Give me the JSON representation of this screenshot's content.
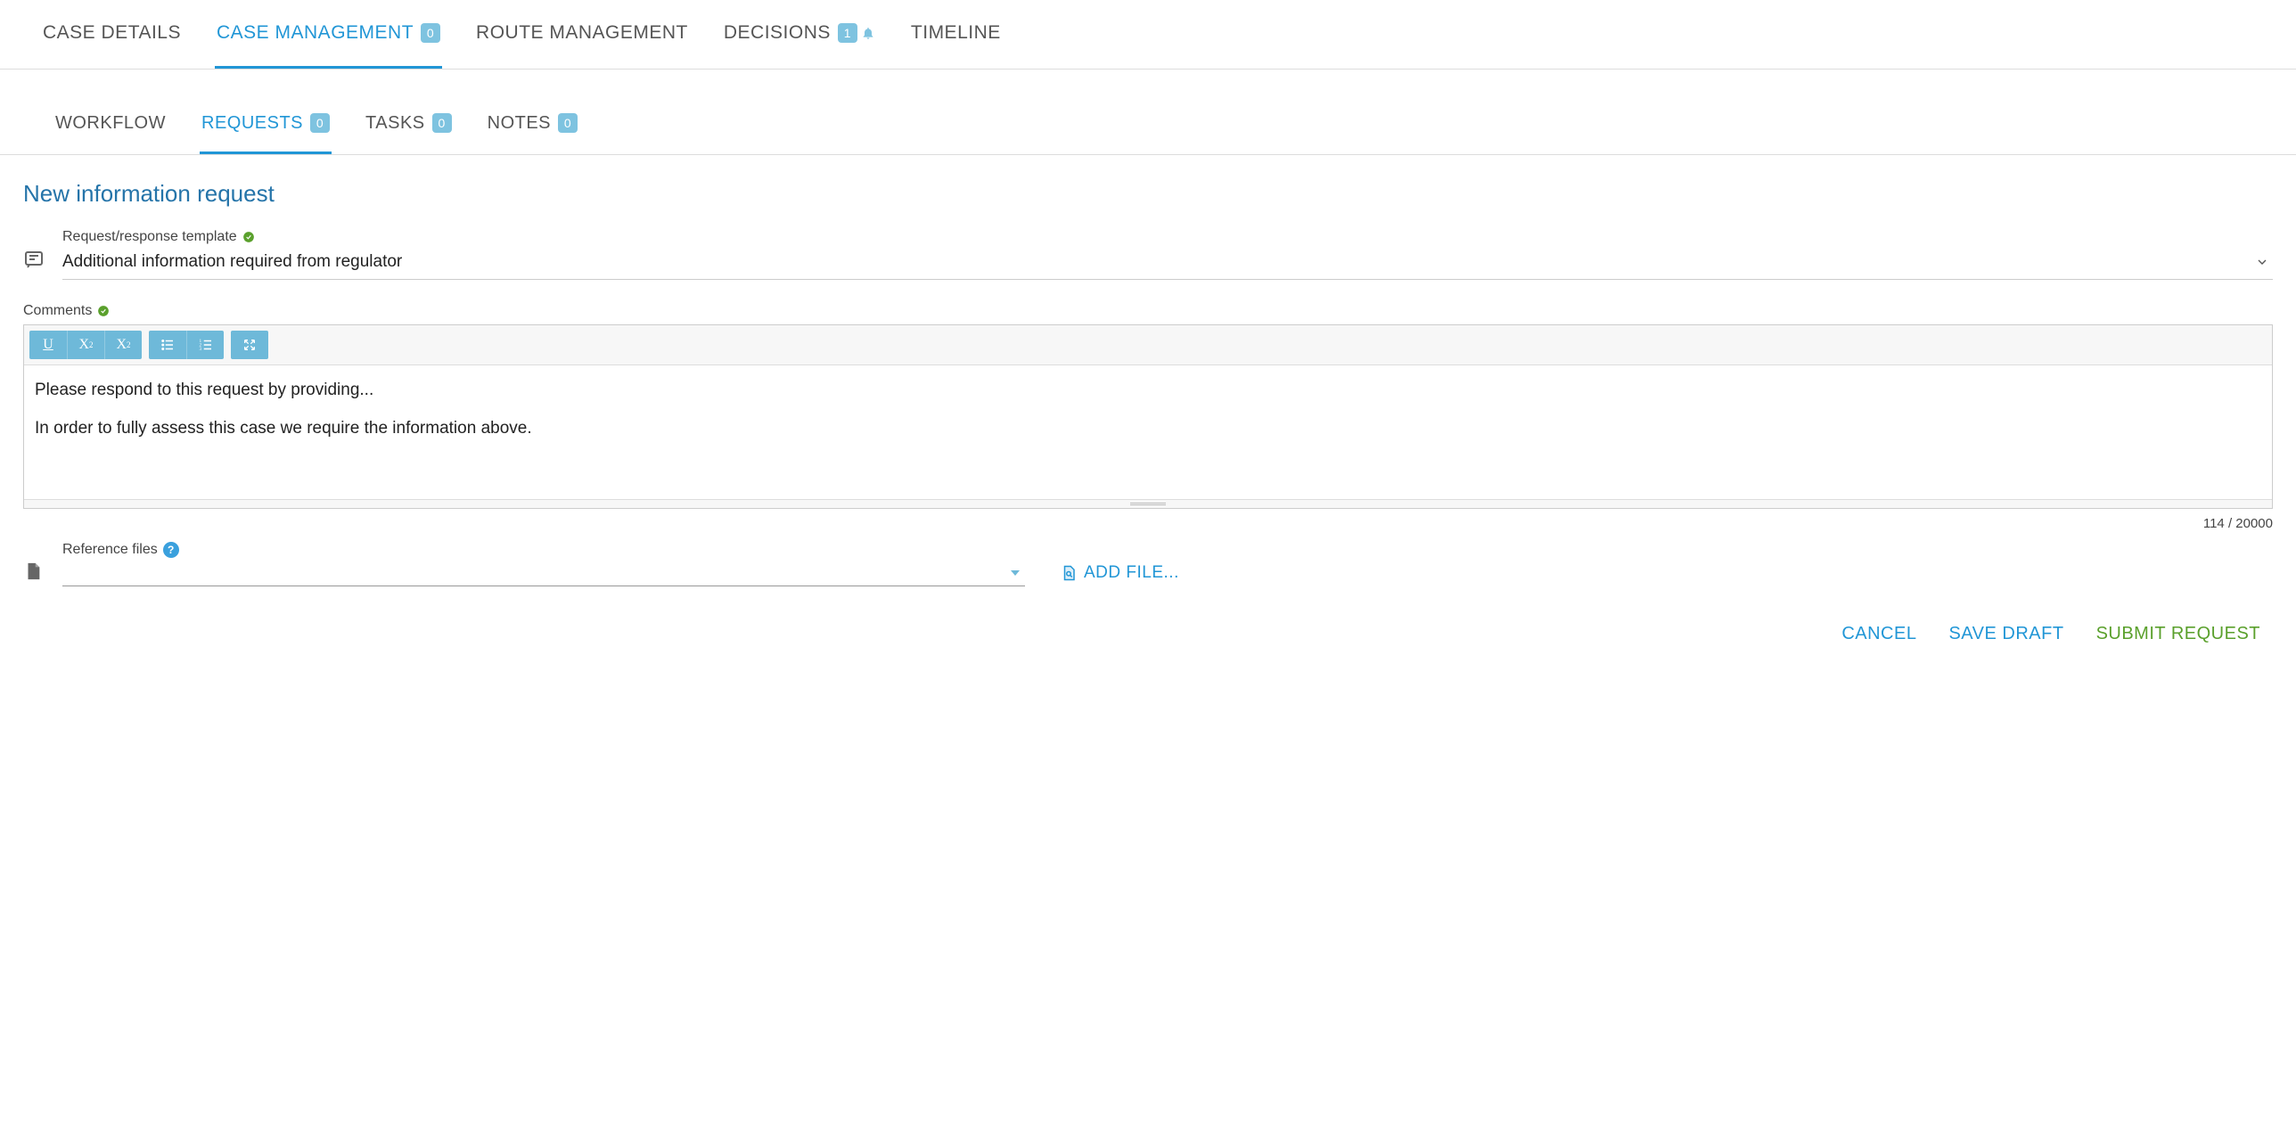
{
  "mainTabs": {
    "caseDetails": "CASE DETAILS",
    "caseManagement": "CASE MANAGEMENT",
    "caseManagementBadge": "0",
    "routeManagement": "ROUTE MANAGEMENT",
    "decisions": "DECISIONS",
    "decisionsBadge": "1",
    "timeline": "TIMELINE"
  },
  "subTabs": {
    "workflow": "WORKFLOW",
    "requests": "REQUESTS",
    "requestsBadge": "0",
    "tasks": "TASKS",
    "tasksBadge": "0",
    "notes": "NOTES",
    "notesBadge": "0"
  },
  "heading": "New information request",
  "template": {
    "label": "Request/response template",
    "value": "Additional information required from regulator"
  },
  "comments": {
    "label": "Comments",
    "line1": "Please respond to this request by providing...",
    "line2": "In order to fully assess this case we require the information above.",
    "count": "114 / 20000"
  },
  "referenceFiles": {
    "label": "Reference files",
    "addFile": "ADD FILE..."
  },
  "actions": {
    "cancel": "CANCEL",
    "saveDraft": "SAVE DRAFT",
    "submit": "SUBMIT REQUEST"
  }
}
